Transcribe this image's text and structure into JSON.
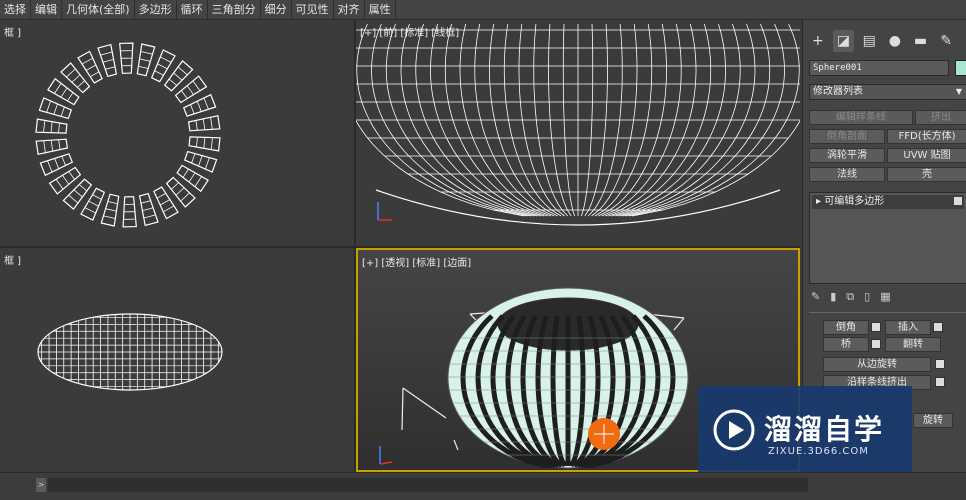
{
  "menu": [
    "选择",
    "编辑",
    "几何体(全部)",
    "多边形",
    "循环",
    "三角剖分",
    "细分",
    "可见性",
    "对齐",
    "属性"
  ],
  "viewports": {
    "top": {
      "label": "框 ]"
    },
    "front": {
      "label": "[+] [前] [标准] [线框]"
    },
    "left": {
      "label": "框 ]"
    },
    "perspective": {
      "label": "[+] [透视] [标准] [边面]"
    }
  },
  "panel": {
    "tabs": [
      "create-icon",
      "modify-icon",
      "hierarchy-icon",
      "motion-icon",
      "display-icon",
      "utilities-icon"
    ],
    "object_name": "Sphere001",
    "color": "#a8e6d0",
    "modifier_list": "修改器列表",
    "buttons": {
      "edit_spline": "编辑样条线",
      "extrude": "挤出",
      "bevel_profile": "倒角剖面",
      "ffd": "FFD(长方体)",
      "turbosmooth": "涡轮平滑",
      "uvw": "UVW 贴图",
      "normal": "法线",
      "shell": "壳"
    },
    "stack_item": "可编辑多边形",
    "sub_buttons": {
      "bridge": "桥",
      "flip": "翻转",
      "hinge": "从边旋转",
      "extrude_spline": "沿样条线挤出",
      "partial1": "倒角",
      "partial2": "插入",
      "partial3": "旋转"
    }
  },
  "watermark": {
    "title": "溜溜自学",
    "url": "ZIXUE.3D66.COM"
  }
}
